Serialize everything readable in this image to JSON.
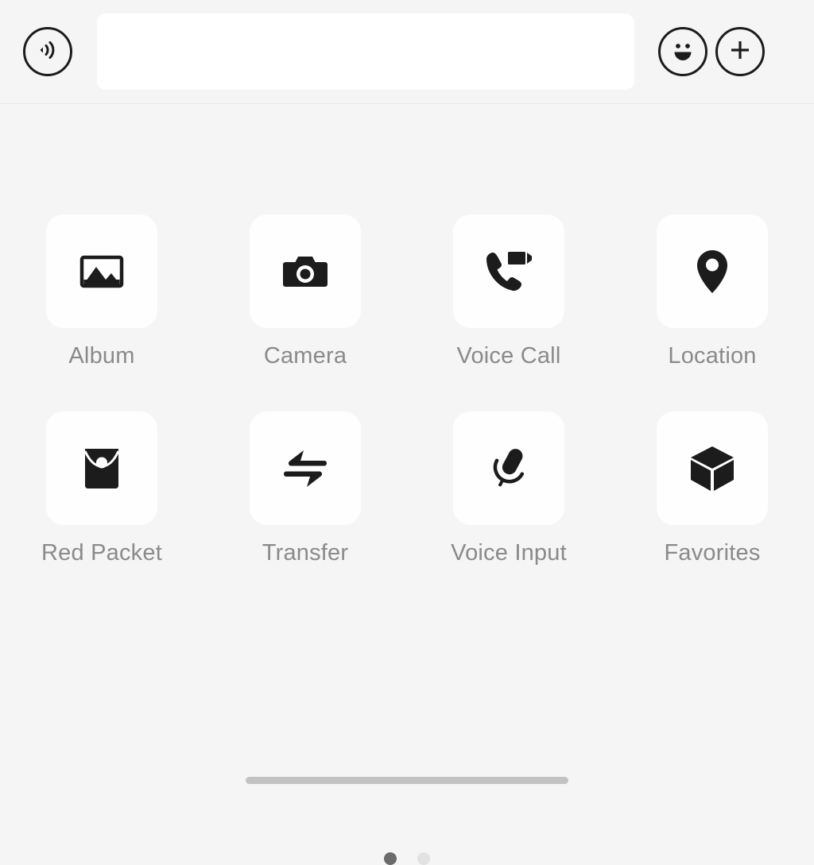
{
  "screen": {
    "name": "chat-attachment-panel",
    "background_color": "#f5f5f5"
  },
  "input_bar": {
    "voice_toggle": {
      "icon": "voice-wave-icon",
      "label": "Voice input toggle"
    },
    "message_input": {
      "value": "",
      "placeholder": ""
    },
    "emoji_button": {
      "icon": "smiley-face-icon",
      "label": "Emoji"
    },
    "add_button": {
      "icon": "plus-circle-icon",
      "label": "More"
    }
  },
  "attachment_grid": {
    "items": [
      {
        "label": "Album",
        "icon": "image-icon"
      },
      {
        "label": "Camera",
        "icon": "camera-icon"
      },
      {
        "label": "Voice Call",
        "icon": "phone-video-icon"
      },
      {
        "label": "Location",
        "icon": "map-pin-icon"
      },
      {
        "label": "Red Packet",
        "icon": "red-packet-icon"
      },
      {
        "label": "Transfer",
        "icon": "transfer-arrows-icon"
      },
      {
        "label": "Voice Input",
        "icon": "microphone-icon"
      },
      {
        "label": "Favorites",
        "icon": "cube-icon"
      }
    ]
  },
  "pagination": {
    "total_pages": 2,
    "current_page": 1
  },
  "colors": {
    "background": "#f5f5f5",
    "tile": "#fefefe",
    "icon": "#1c1c1c",
    "label_text": "#8a8a8a",
    "dot_active": "#6b6b6b",
    "dot_inactive": "#e2e2e2",
    "home_indicator": "#c2c2c2"
  }
}
